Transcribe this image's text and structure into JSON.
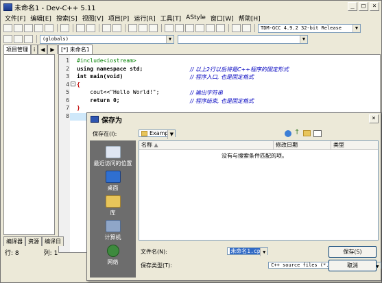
{
  "window": {
    "title": "未命名1 - Dev-C++ 5.11",
    "min": "_",
    "max": "□",
    "close": "×"
  },
  "menu": [
    "文件[F]",
    "编辑[E]",
    "搜索[S]",
    "视图[V]",
    "项目[P]",
    "运行[R]",
    "工具[T]",
    "AStyle",
    "窗口[W]",
    "帮助[H]"
  ],
  "toolbar": {
    "compiler": "TDM-GCC 4.9.2 32-bit Release",
    "scope": "(globals)"
  },
  "left_tabs": [
    "项目管理",
    "i"
  ],
  "editor_tab": "[*] 未命名1",
  "code": {
    "lines": [
      {
        "n": "1",
        "text": "#include<iostream>",
        "comment": ""
      },
      {
        "n": "2",
        "text": "using namespace std;",
        "comment": "// 以上2行以后将是C++程序的固定形式"
      },
      {
        "n": "3",
        "text": "int main(void)",
        "comment": "// 程序入口, 也是固定格式"
      },
      {
        "n": "4",
        "text": "{",
        "comment": ""
      },
      {
        "n": "5",
        "text": "    cout<<\"Hello World!\";",
        "comment": "// 输出字符串"
      },
      {
        "n": "6",
        "text": "    return 0;",
        "comment": "// 程序结束, 也是固定格式"
      },
      {
        "n": "7",
        "text": "}",
        "comment": ""
      },
      {
        "n": "8",
        "text": "",
        "comment": ""
      }
    ]
  },
  "bottom_tabs": [
    "编译器",
    "资源",
    "编译日"
  ],
  "status": {
    "row_label": "行:",
    "row": "8",
    "col_label": "列:",
    "col": "1"
  },
  "dialog": {
    "title": "保存为",
    "close": "×",
    "save_in_label": "保存在(I):",
    "save_in_value": "Example",
    "places": [
      "最近访问的位置",
      "桌面",
      "库",
      "计算机",
      "网络"
    ],
    "columns": [
      "名称",
      "修改日期",
      "类型"
    ],
    "empty_text": "没有与搜索条件匹配的项。",
    "filename_label": "文件名(N):",
    "filename_value": "未命名1.cpp",
    "filetype_label": "保存类型(T):",
    "filetype_value": "C++ source files (*.cpp;*.cc;*.cxx;*.c",
    "save_button": "保存(S)",
    "cancel_button": "取消"
  }
}
